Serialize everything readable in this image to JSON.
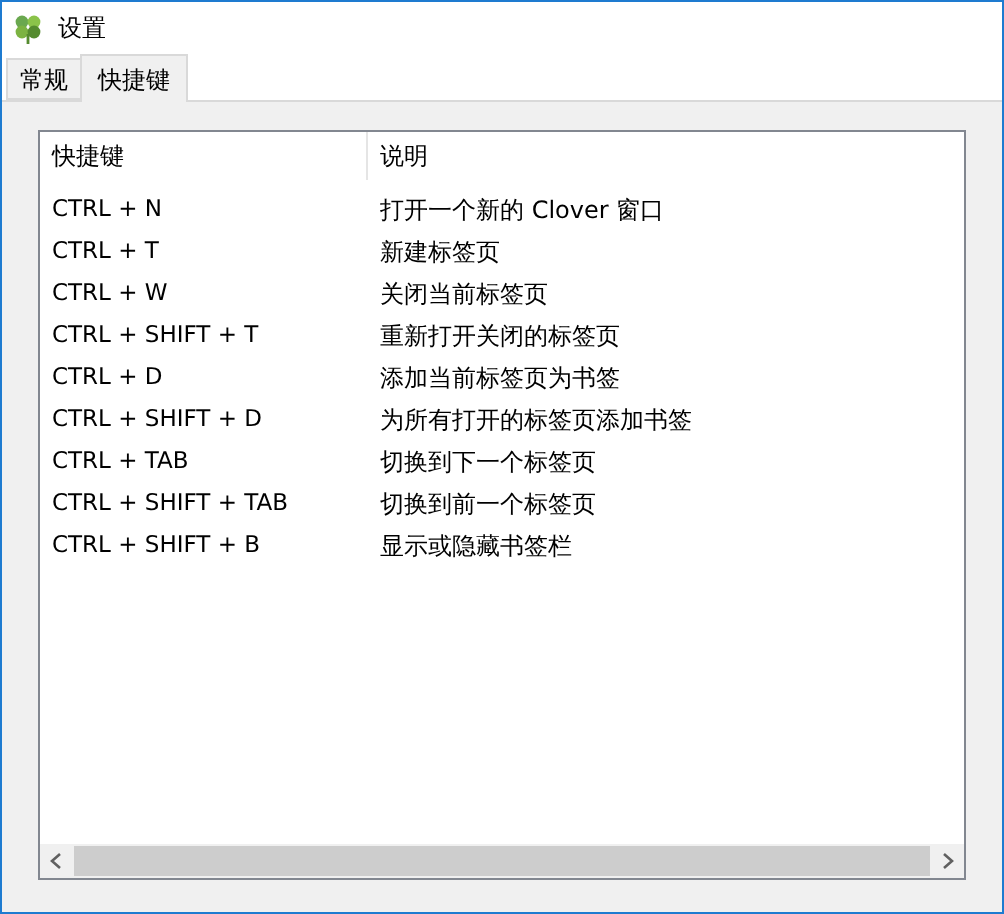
{
  "window": {
    "title": "设置"
  },
  "tabs": [
    {
      "label": "常规",
      "selected": false
    },
    {
      "label": "快捷键",
      "selected": true
    }
  ],
  "table": {
    "columns": [
      "快捷键",
      "说明"
    ],
    "rows": [
      [
        "CTRL + N",
        "打开一个新的 Clover 窗口"
      ],
      [
        "CTRL + T",
        "新建标签页"
      ],
      [
        "CTRL + W",
        "关闭当前标签页"
      ],
      [
        "CTRL + SHIFT + T",
        "重新打开关闭的标签页"
      ],
      [
        "CTRL + D",
        "添加当前标签页为书签"
      ],
      [
        "CTRL + SHIFT + D",
        "为所有打开的标签页添加书签"
      ],
      [
        "CTRL + TAB",
        "切换到下一个标签页"
      ],
      [
        "CTRL + SHIFT + TAB",
        "切换到前一个标签页"
      ],
      [
        "CTRL + SHIFT + B",
        "显示或隐藏书签栏"
      ]
    ]
  }
}
